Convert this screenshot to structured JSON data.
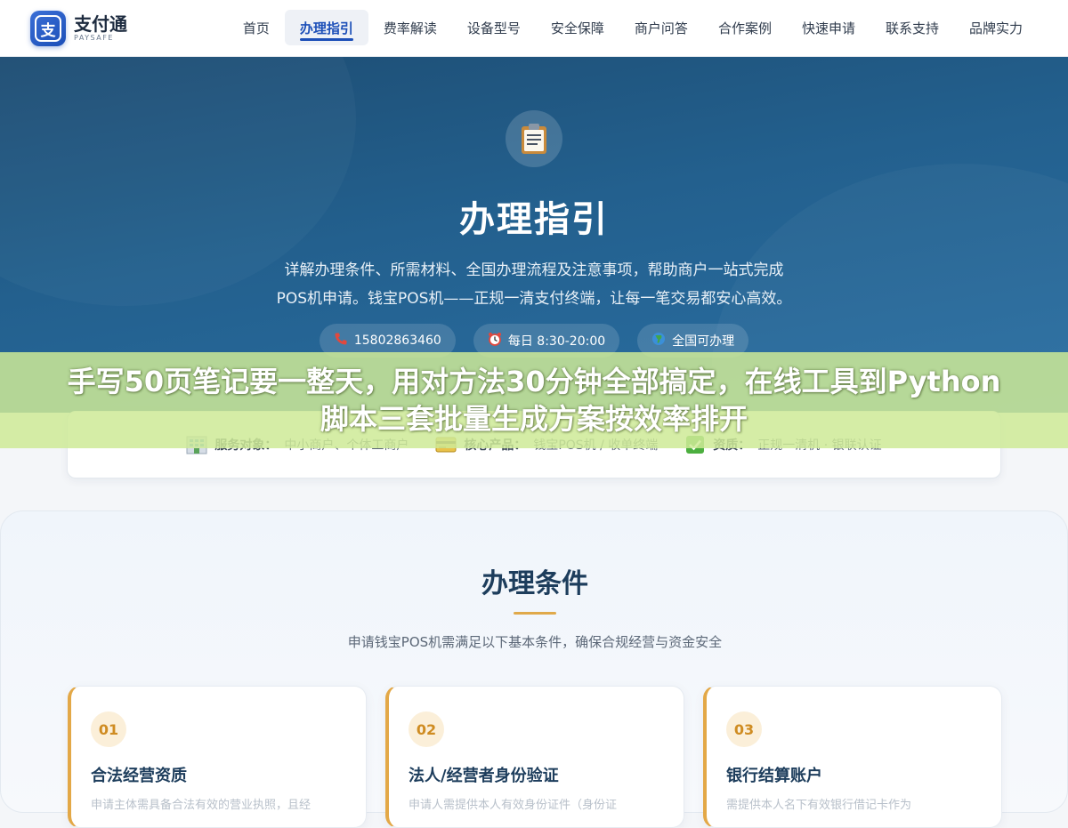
{
  "header": {
    "logo_mark": "支",
    "logo_name": "支付通",
    "logo_sub": "PAYSAFE",
    "nav": [
      {
        "label": "首页"
      },
      {
        "label": "办理指引",
        "active": true
      },
      {
        "label": "费率解读"
      },
      {
        "label": "设备型号"
      },
      {
        "label": "安全保障"
      },
      {
        "label": "商户问答"
      },
      {
        "label": "合作案例"
      },
      {
        "label": "快速申请"
      },
      {
        "label": "联系支持"
      },
      {
        "label": "品牌实力"
      }
    ]
  },
  "hero": {
    "icon": "clipboard-icon",
    "title": "办理指引",
    "desc_line1": "详解办理条件、所需材料、全国办理流程及注意事项，帮助商户一站式完成",
    "desc_line2": "POS机申请。钱宝POS机——正规一清支付终端，让每一笔交易都安心高效。",
    "chips": {
      "phone": {
        "icon": "phone-icon",
        "text": "15802863460"
      },
      "hours": {
        "icon": "alarm-clock-icon",
        "text": "每日 8:30-20:00"
      },
      "coverage": {
        "icon": "globe-icon",
        "text": "全国可办理"
      }
    }
  },
  "info": {
    "service": {
      "icon": "building-icon",
      "key": "服务对象：",
      "value": "中小商户、个体工商户"
    },
    "product": {
      "icon": "credit-card-icon",
      "key": "核心产品：",
      "value": "钱宝POS机 / 收单终端"
    },
    "qualification": {
      "icon": "check-box-icon",
      "key": "资质：",
      "value": "正规一清机 · 银联认证"
    }
  },
  "banner": {
    "line1": "手写50页笔记要一整天，用对方法30分钟全部搞定，在线工具到Python",
    "line2": "脚本三套批量生成方案按效率排开"
  },
  "conditions": {
    "title": "办理条件",
    "subtitle": "申请钱宝POS机需满足以下基本条件，确保合规经营与资金安全",
    "cards": [
      {
        "num": "01",
        "title": "合法经营资质",
        "text": "申请主体需具备合法有效的营业执照，且经"
      },
      {
        "num": "02",
        "title": "法人/经营者身份验证",
        "text": "申请人需提供本人有效身份证件（身份证"
      },
      {
        "num": "03",
        "title": "银行结算账户",
        "text": "需提供本人名下有效银行借记卡作为"
      }
    ]
  },
  "colors": {
    "brand": "#1c4fb8",
    "hero_bg": "#23608e",
    "accent": "#e0a94a",
    "banner": "#ceea96"
  }
}
